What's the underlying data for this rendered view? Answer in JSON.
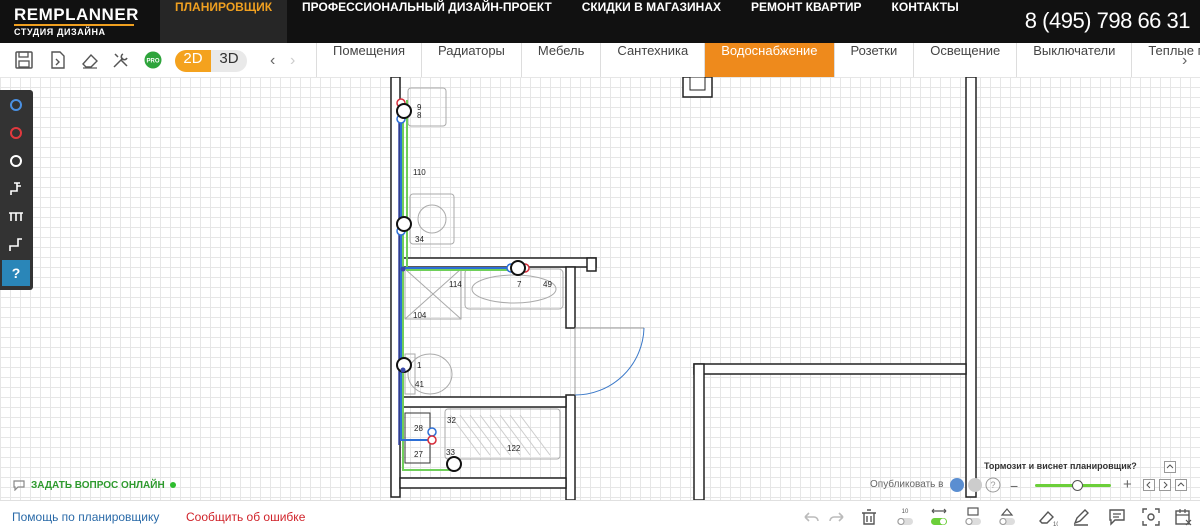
{
  "header": {
    "logo_line1_a": "REM",
    "logo_line1_b": "PLANNER",
    "logo_line2": "СТУДИЯ ДИЗАЙНА",
    "nav": [
      {
        "label": "ПЛАНИРОВЩИК",
        "active": true
      },
      {
        "label": "ПРОФЕССИОНАЛЬНЫЙ ДИЗАЙН-ПРОЕКТ"
      },
      {
        "label": "СКИДКИ В МАГАЗИНАХ"
      },
      {
        "label": "РЕМОНТ КВАРТИР"
      },
      {
        "label": "КОНТАКТЫ"
      }
    ],
    "phone_prefix": "8 (495) ",
    "phone_number": "798 66 31"
  },
  "toolbar": {
    "pro_label": "PRO",
    "mode_2d": "2D",
    "mode_3d": "3D",
    "prev_arrow": "‹",
    "faded_arrow": "›",
    "tabs": [
      {
        "label": "Помещения"
      },
      {
        "label": "Радиаторы"
      },
      {
        "label": "Мебель"
      },
      {
        "label": "Сантехника"
      },
      {
        "label": "Водоснабжение",
        "active": true
      },
      {
        "label": "Розетки"
      },
      {
        "label": "Освещение"
      },
      {
        "label": "Выключатели"
      },
      {
        "label": "Теплые полы"
      }
    ],
    "next_arrow": "›"
  },
  "left_tools": {
    "help_label": "?"
  },
  "plan_labels": {
    "a": "9",
    "b": "8",
    "c": "110",
    "d": "34",
    "e": "114",
    "f": "7",
    "g": "49",
    "h": "104",
    "i": "1",
    "j": "41",
    "k": "32",
    "l": "28",
    "m": "27",
    "n": "33",
    "o": "122"
  },
  "footer_overlay": {
    "ask_online": "ЗАДАТЬ ВОПРОС ОНЛАЙН",
    "publish": "Опубликовать в",
    "slow_question": "Тормозит и виснет планировщик?",
    "zoom_minus": "−",
    "zoom_plus": "+",
    "zoom_level": 0.55
  },
  "bottom": {
    "help_link": "Помощь по планировщику",
    "report_link": "Сообщить об ошибке"
  },
  "colors": {
    "accent": "#ee8a1c",
    "nav_active": "#f0a020",
    "cold_pipe": "#2d6fd6",
    "hot_pipe": "#d62d3a",
    "drain_pipe": "#6fcf5a",
    "help_blue": "#2a86b8"
  }
}
